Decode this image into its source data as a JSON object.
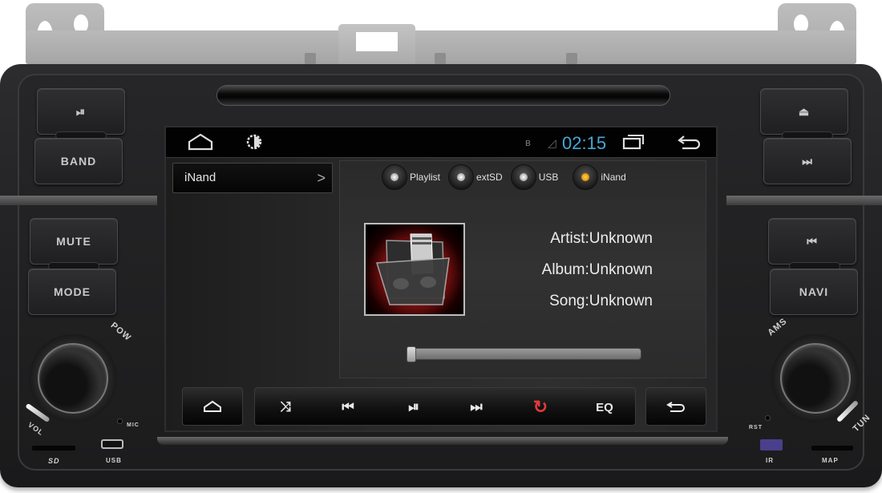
{
  "statusbar": {
    "home_icon": "home-icon",
    "brightness_icon": "brightness-icon",
    "bluetooth_icon": "bluetooth-icon",
    "signal_icon": "signal-icon",
    "time": "02:15",
    "recents_icon": "recents-icon",
    "back_icon": "back-icon",
    "clock_color": "#49a7d6"
  },
  "source_panel": {
    "current": "iNand",
    "chevron": ">"
  },
  "source_tabs": [
    {
      "label": "Playlist",
      "active": false
    },
    {
      "label": "extSD",
      "active": false
    },
    {
      "label": "USB",
      "active": false
    },
    {
      "label": "iNand",
      "active": true
    }
  ],
  "track": {
    "artist": "Artist:Unknown",
    "album": "Album:Unknown",
    "song": "Song:Unknown",
    "progress_percent": 0
  },
  "controls": {
    "home": "⌂",
    "shuffle": "⤨",
    "prev": "⏮",
    "play_pause": "⏯",
    "next": "⏭",
    "repeat": "↻",
    "eq": "EQ",
    "back": "↩",
    "repeat_color": "#e23a3a"
  },
  "hardware": {
    "left_buttons": [
      "⏯",
      "BAND",
      "MUTE",
      "MODE"
    ],
    "right_buttons": [
      "⏏",
      "⏭",
      "⏮",
      "NAVI"
    ],
    "labels": {
      "pow": "POW",
      "vol": "VOL",
      "mic": "MIC",
      "sd": "SD",
      "usb": "USB",
      "ams": "AMS",
      "tun": "TUN",
      "rst": "RST",
      "ir": "IR",
      "map": "MAP"
    },
    "ir_color": "#4a3f8c"
  }
}
